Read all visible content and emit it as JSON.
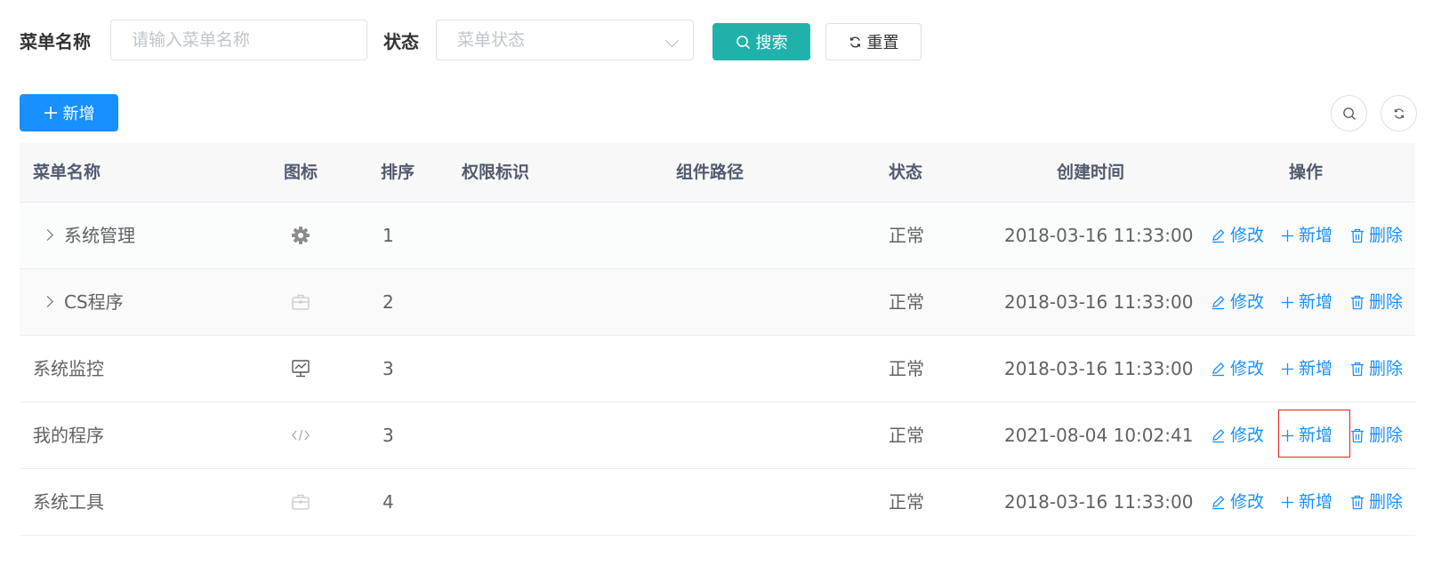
{
  "search_form": {
    "menu_name_label": "菜单名称",
    "menu_name_placeholder": "请输入菜单名称",
    "status_label": "状态",
    "status_placeholder": "菜单状态",
    "search_button": "搜索",
    "reset_button": "重置"
  },
  "toolbar": {
    "add_button": "新增"
  },
  "table": {
    "columns": [
      "菜单名称",
      "图标",
      "排序",
      "权限标识",
      "组件路径",
      "状态",
      "创建时间",
      "操作"
    ],
    "rows": [
      {
        "name": "系统管理",
        "icon": "gear-icon",
        "order": "1",
        "perms": "",
        "component": "",
        "status": "正常",
        "created": "2018-03-16 11:33:00",
        "expandable": true
      },
      {
        "name": "CS程序",
        "icon": "briefcase-icon",
        "order": "2",
        "perms": "",
        "component": "",
        "status": "正常",
        "created": "2018-03-16 11:33:00",
        "expandable": true
      },
      {
        "name": "系统监控",
        "icon": "monitor-icon",
        "order": "3",
        "perms": "",
        "component": "",
        "status": "正常",
        "created": "2018-03-16 11:33:00",
        "expandable": false
      },
      {
        "name": "我的程序",
        "icon": "code-icon",
        "order": "3",
        "perms": "",
        "component": "",
        "status": "正常",
        "created": "2021-08-04 10:02:41",
        "expandable": false
      },
      {
        "name": "系统工具",
        "icon": "briefcase-icon",
        "order": "4",
        "perms": "",
        "component": "",
        "status": "正常",
        "created": "2018-03-16 11:33:00",
        "expandable": false
      }
    ],
    "actions": {
      "edit": "修改",
      "add": "新增",
      "delete": "删除"
    }
  },
  "colors": {
    "primary": "#1890ff",
    "search_button": "#20b2aa",
    "highlight": "#e02020"
  }
}
